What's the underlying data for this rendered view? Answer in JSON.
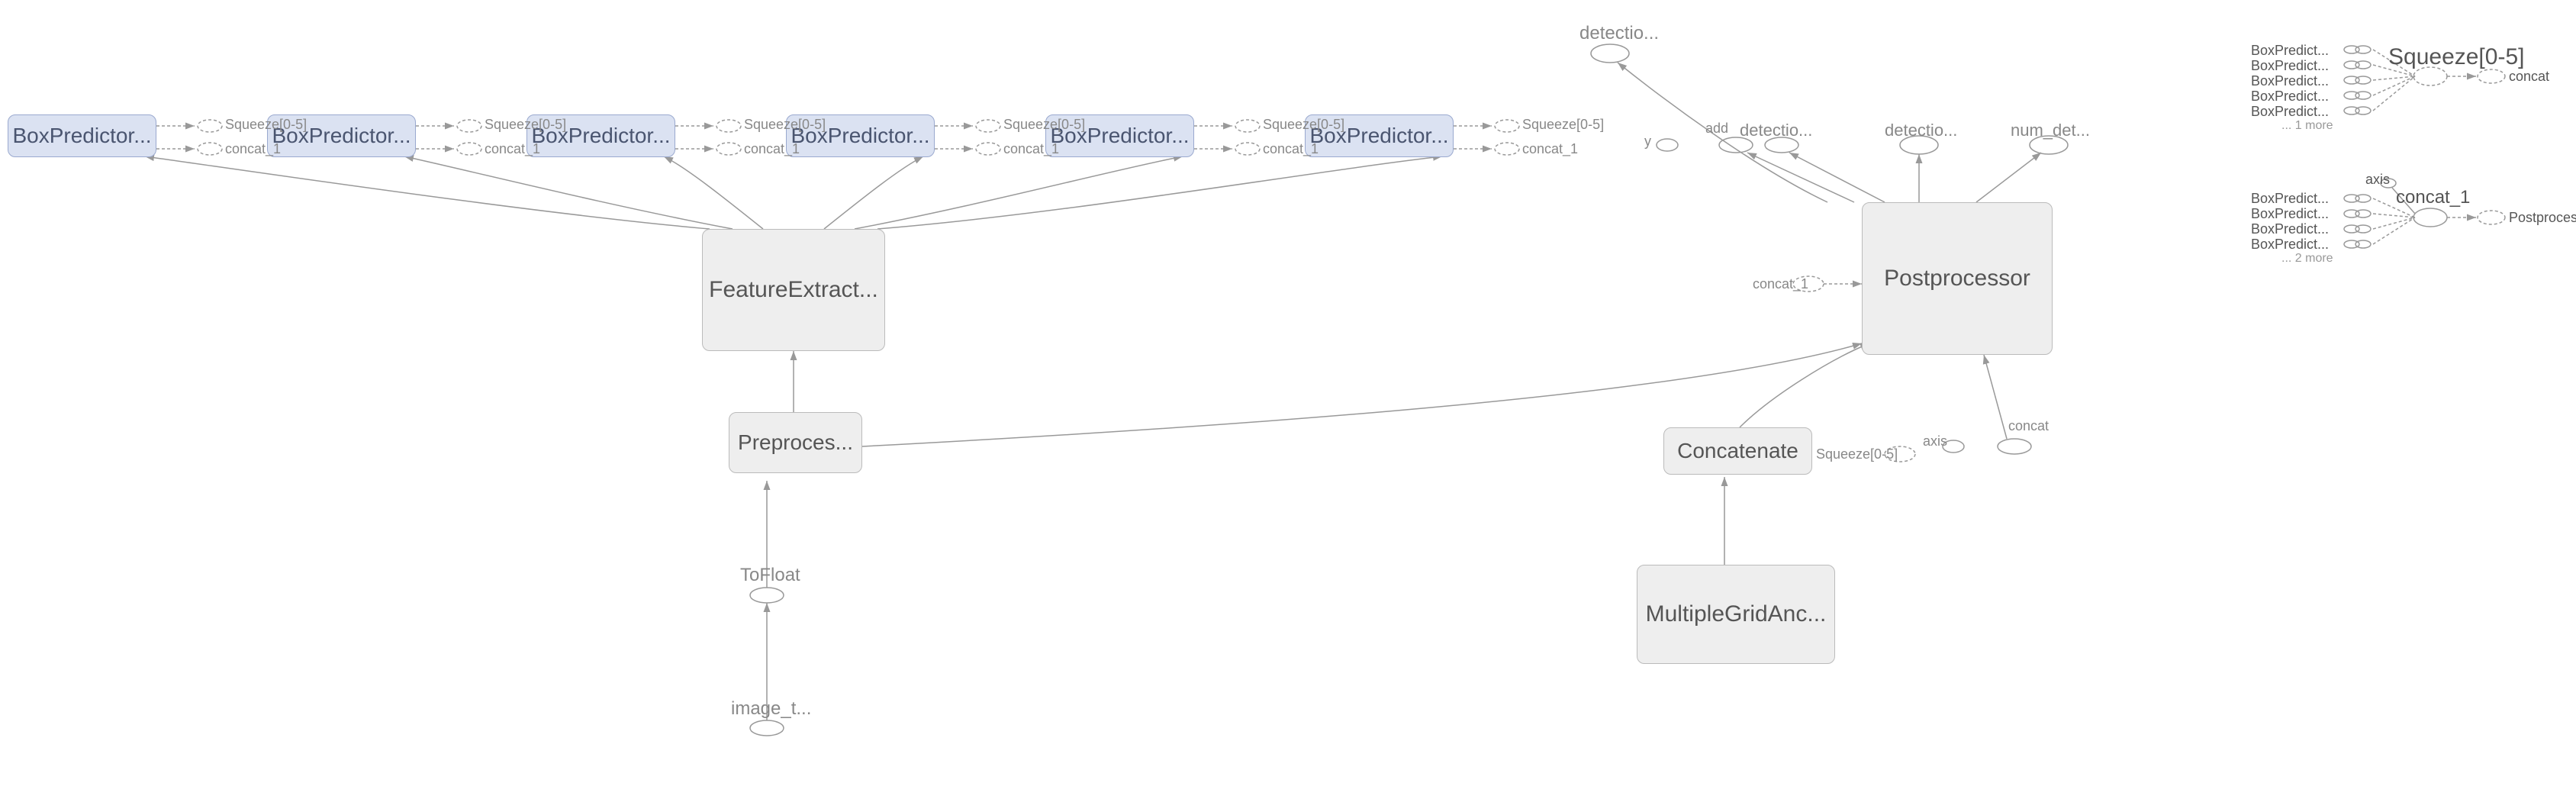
{
  "chart_data": {
    "type": "graph",
    "title": "",
    "main": {
      "box_predictors": [
        "BoxPredictor...",
        "BoxPredictor...",
        "BoxPredictor...",
        "BoxPredictor...",
        "BoxPredictor...",
        "BoxPredictor..."
      ],
      "per_predictor_outputs": {
        "squeeze": "Squeeze[0-5]",
        "concat": "concat_1"
      },
      "feature_extractor": "FeatureExtract...",
      "preprocessor": "Preproces...",
      "tofloat": "ToFloat",
      "image_tensor": "image_t...",
      "postprocessor": "Postprocessor",
      "post_inputs": {
        "concat1": "concat_1",
        "concat": "concat",
        "axis": "axis",
        "squeeze": "Squeeze[0-5]"
      },
      "post_outputs": {
        "detectio_a": "detectio...",
        "add": "add",
        "detectio_b": "detectio...",
        "detectio_c": "detectio...",
        "num_det": "num_det...",
        "y": "y"
      },
      "concatenate": "Concatenate",
      "multiple_grid_anc": "MultipleGridAnc..."
    },
    "side_a": {
      "title": "Squeeze[0-5]",
      "inputs": [
        "BoxPredict...",
        "BoxPredict...",
        "BoxPredict...",
        "BoxPredict...",
        "BoxPredict..."
      ],
      "more": "... 1 more",
      "output": "concat"
    },
    "side_b": {
      "title": "concat_1",
      "axis": "axis",
      "inputs": [
        "BoxPredict...",
        "BoxPredict...",
        "BoxPredict...",
        "BoxPredict..."
      ],
      "more": "... 2 more",
      "output": "Postproces..."
    }
  }
}
